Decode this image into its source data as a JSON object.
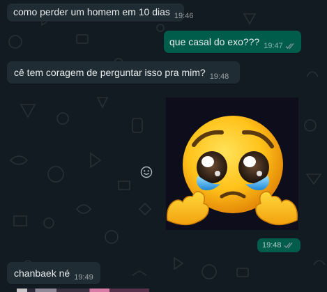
{
  "messages": [
    {
      "text": "como perder um homem em 10 dias",
      "time": "19:46"
    },
    {
      "text": "que casal do exo???",
      "time": "19:47"
    },
    {
      "text": "cê tem coragem de perguntar isso pra mim?",
      "time": "19:48"
    },
    {
      "time": "19:48"
    },
    {
      "text": "chanbaek né",
      "time": "19:49"
    }
  ],
  "icons": {
    "reaction": "smiley-icon",
    "read_receipt": "double-check-icon"
  },
  "colors": {
    "background": "#111b21",
    "incoming_bubble": "#202c33",
    "outgoing_bubble": "#005c4b",
    "read_tick": "#53bdeb"
  }
}
